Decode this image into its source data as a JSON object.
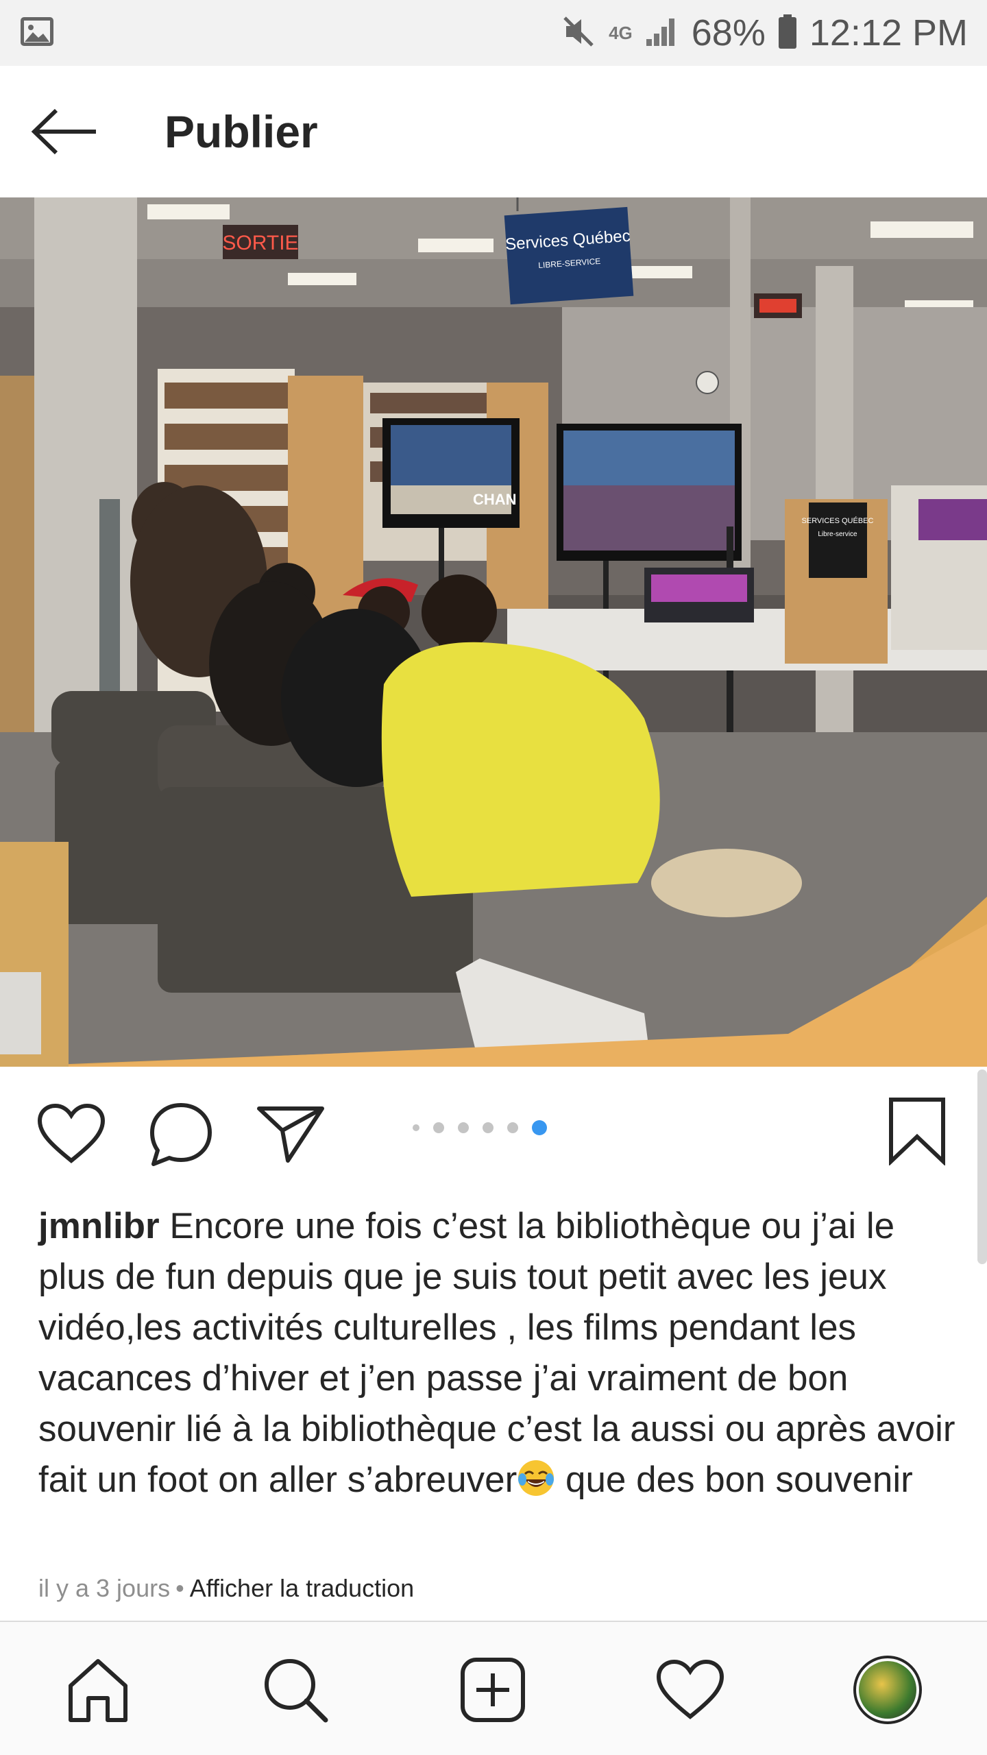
{
  "status_bar": {
    "battery": "68%",
    "time": "12:12 PM",
    "network": "4G"
  },
  "header": {
    "title": "Publier"
  },
  "photo": {
    "sign_exit": "SORTIE",
    "sign_services": "Services Québec",
    "sign_services_sub": "LIBRE-SERVICE",
    "booth_sign": "SERVICES QUÉBEC",
    "booth_sign_sub": "Libre-service",
    "tv_text": "CHAN"
  },
  "carousel": {
    "count": 6,
    "active_index": 5
  },
  "post": {
    "username": "jmnlibr",
    "caption_before_emoji": " Encore une fois c’est la bibliothèque ou j’ai le plus de fun depuis que je suis tout petit avec les jeux vidéo,les activités culturelles , les films pendant les vacances d’hiver et j’en passe j’ai vraiment de bon souvenir lié à la bibliothèque c’est la aussi ou après avoir fait un foot on aller s’abreuver",
    "caption_after_emoji": " que des bon souvenir",
    "emoji": "tears-of-joy-emoji",
    "time_ago": "il y a 3 jours",
    "separator": "•",
    "translate_link": "Afficher la traduction"
  },
  "colors": {
    "accent": "#3897f0",
    "text": "#262626",
    "muted": "#8e8e8e",
    "status_bg": "#f2f2f2"
  }
}
